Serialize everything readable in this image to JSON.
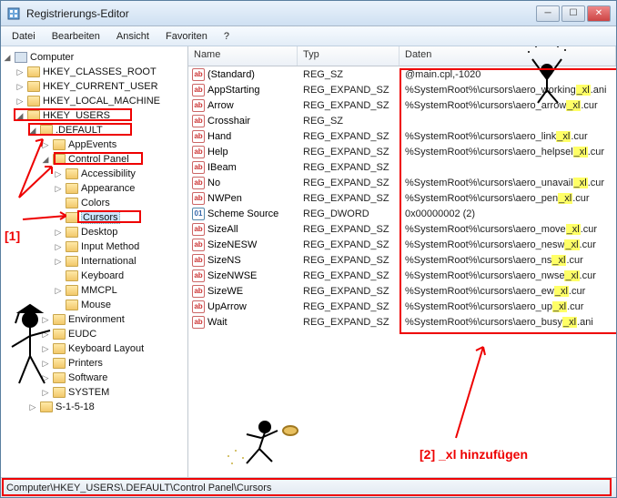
{
  "window": {
    "title": "Registrierungs-Editor"
  },
  "menu": [
    "Datei",
    "Bearbeiten",
    "Ansicht",
    "Favoriten",
    "?"
  ],
  "tree": [
    {
      "ind": 0,
      "exp": "◢",
      "kind": "pc",
      "label": "Computer"
    },
    {
      "ind": 1,
      "exp": "▷",
      "kind": "fld",
      "label": "HKEY_CLASSES_ROOT"
    },
    {
      "ind": 1,
      "exp": "▷",
      "kind": "fld",
      "label": "HKEY_CURRENT_USER"
    },
    {
      "ind": 1,
      "exp": "▷",
      "kind": "fld",
      "label": "HKEY_LOCAL_MACHINE"
    },
    {
      "ind": 1,
      "exp": "◢",
      "kind": "fld",
      "label": "HKEY_USERS",
      "box": true
    },
    {
      "ind": 2,
      "exp": "◢",
      "kind": "fld",
      "label": ".DEFAULT",
      "box": true
    },
    {
      "ind": 3,
      "exp": "▷",
      "kind": "fld",
      "label": "AppEvents"
    },
    {
      "ind": 3,
      "exp": "◢",
      "kind": "fld",
      "label": "Control Panel",
      "box": true
    },
    {
      "ind": 4,
      "exp": "▷",
      "kind": "fld",
      "label": "Accessibility"
    },
    {
      "ind": 4,
      "exp": "▷",
      "kind": "fld",
      "label": "Appearance"
    },
    {
      "ind": 4,
      "exp": "",
      "kind": "fld",
      "label": "Colors"
    },
    {
      "ind": 4,
      "exp": "",
      "kind": "fld",
      "label": "Cursors",
      "sel": true,
      "box": true
    },
    {
      "ind": 4,
      "exp": "▷",
      "kind": "fld",
      "label": "Desktop"
    },
    {
      "ind": 4,
      "exp": "▷",
      "kind": "fld",
      "label": "Input Method"
    },
    {
      "ind": 4,
      "exp": "▷",
      "kind": "fld",
      "label": "International"
    },
    {
      "ind": 4,
      "exp": "",
      "kind": "fld",
      "label": "Keyboard"
    },
    {
      "ind": 4,
      "exp": "▷",
      "kind": "fld",
      "label": "MMCPL"
    },
    {
      "ind": 4,
      "exp": "",
      "kind": "fld",
      "label": "Mouse"
    },
    {
      "ind": 3,
      "exp": "▷",
      "kind": "fld",
      "label": "Environment"
    },
    {
      "ind": 3,
      "exp": "▷",
      "kind": "fld",
      "label": "EUDC"
    },
    {
      "ind": 3,
      "exp": "▷",
      "kind": "fld",
      "label": "Keyboard Layout"
    },
    {
      "ind": 3,
      "exp": "▷",
      "kind": "fld",
      "label": "Printers"
    },
    {
      "ind": 3,
      "exp": "▷",
      "kind": "fld",
      "label": "Software"
    },
    {
      "ind": 3,
      "exp": "▷",
      "kind": "fld",
      "label": "SYSTEM"
    },
    {
      "ind": 2,
      "exp": "▷",
      "kind": "fld",
      "label": "S-1-5-18"
    }
  ],
  "list": {
    "headers": {
      "name": "Name",
      "type": "Typ",
      "data": "Daten"
    },
    "rows": [
      {
        "icon": "str",
        "name": "(Standard)",
        "type": "REG_SZ",
        "pre": "@main.cpl,-1020",
        "hl": "",
        "post": ""
      },
      {
        "icon": "str",
        "name": "AppStarting",
        "type": "REG_EXPAND_SZ",
        "pre": "%SystemRoot%\\cursors\\aero_working",
        "hl": "_xl",
        "post": ".ani"
      },
      {
        "icon": "str",
        "name": "Arrow",
        "type": "REG_EXPAND_SZ",
        "pre": "%SystemRoot%\\cursors\\aero_arrow",
        "hl": "_xl",
        "post": ".cur"
      },
      {
        "icon": "str",
        "name": "Crosshair",
        "type": "REG_SZ",
        "pre": "",
        "hl": "",
        "post": ""
      },
      {
        "icon": "str",
        "name": "Hand",
        "type": "REG_EXPAND_SZ",
        "pre": "%SystemRoot%\\cursors\\aero_link",
        "hl": "_xl",
        "post": ".cur"
      },
      {
        "icon": "str",
        "name": "Help",
        "type": "REG_EXPAND_SZ",
        "pre": "%SystemRoot%\\cursors\\aero_helpsel",
        "hl": "_xl",
        "post": ".cur"
      },
      {
        "icon": "str",
        "name": "IBeam",
        "type": "REG_EXPAND_SZ",
        "pre": "",
        "hl": "",
        "post": ""
      },
      {
        "icon": "str",
        "name": "No",
        "type": "REG_EXPAND_SZ",
        "pre": "%SystemRoot%\\cursors\\aero_unavail",
        "hl": "_xl",
        "post": ".cur"
      },
      {
        "icon": "str",
        "name": "NWPen",
        "type": "REG_EXPAND_SZ",
        "pre": "%SystemRoot%\\cursors\\aero_pen",
        "hl": "_xl",
        "post": ".cur"
      },
      {
        "icon": "bin",
        "name": "Scheme Source",
        "type": "REG_DWORD",
        "pre": "0x00000002 (2)",
        "hl": "",
        "post": ""
      },
      {
        "icon": "str",
        "name": "SizeAll",
        "type": "REG_EXPAND_SZ",
        "pre": "%SystemRoot%\\cursors\\aero_move",
        "hl": "_xl",
        "post": ".cur"
      },
      {
        "icon": "str",
        "name": "SizeNESW",
        "type": "REG_EXPAND_SZ",
        "pre": "%SystemRoot%\\cursors\\aero_nesw",
        "hl": "_xl",
        "post": ".cur"
      },
      {
        "icon": "str",
        "name": "SizeNS",
        "type": "REG_EXPAND_SZ",
        "pre": "%SystemRoot%\\cursors\\aero_ns",
        "hl": "_xl",
        "post": ".cur"
      },
      {
        "icon": "str",
        "name": "SizeNWSE",
        "type": "REG_EXPAND_SZ",
        "pre": "%SystemRoot%\\cursors\\aero_nwse",
        "hl": "_xl",
        "post": ".cur"
      },
      {
        "icon": "str",
        "name": "SizeWE",
        "type": "REG_EXPAND_SZ",
        "pre": "%SystemRoot%\\cursors\\aero_ew",
        "hl": "_xl",
        "post": ".cur"
      },
      {
        "icon": "str",
        "name": "UpArrow",
        "type": "REG_EXPAND_SZ",
        "pre": "%SystemRoot%\\cursors\\aero_up",
        "hl": "_xl",
        "post": ".cur"
      },
      {
        "icon": "str",
        "name": "Wait",
        "type": "REG_EXPAND_SZ",
        "pre": "%SystemRoot%\\cursors\\aero_busy",
        "hl": "_xl",
        "post": ".ani"
      }
    ]
  },
  "status": "Computer\\HKEY_USERS\\.DEFAULT\\Control Panel\\Cursors",
  "annotations": {
    "label1": "[1]",
    "label2": "[2] _xl hinzufügen"
  }
}
